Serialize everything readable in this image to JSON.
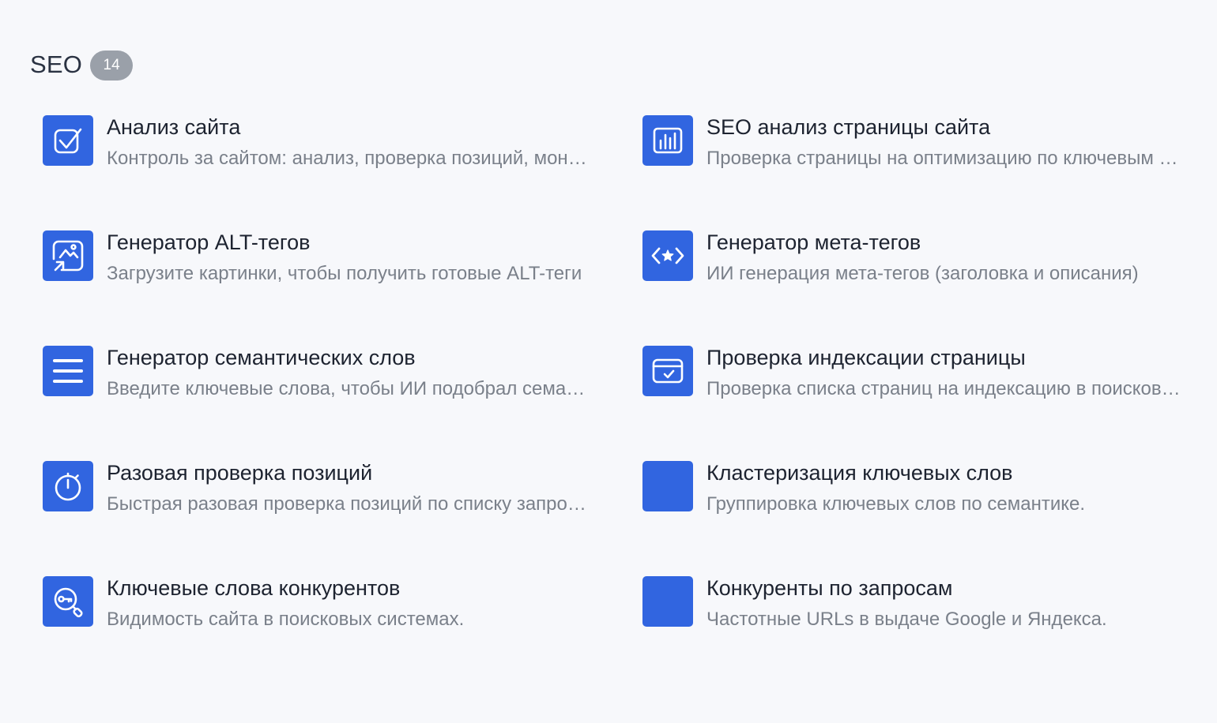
{
  "section": {
    "title": "SEO",
    "count": "14"
  },
  "tools": [
    {
      "title": "Анализ сайта",
      "desc": "Контроль за сайтом: анализ, проверка позиций, мониторинг",
      "icon": "check-icon"
    },
    {
      "title": "SEO анализ страницы сайта",
      "desc": "Проверка страницы на оптимизацию по ключевым словам",
      "icon": "bar-chart-icon"
    },
    {
      "title": "Генератор ALT-тегов",
      "desc": "Загрузите картинки, чтобы получить готовые ALT-теги",
      "icon": "image-upload-icon"
    },
    {
      "title": "Генератор мета-тегов",
      "desc": "ИИ генерация мета-тегов (заголовка и описания)",
      "icon": "code-star-icon"
    },
    {
      "title": "Генератор семантических слов",
      "desc": "Введите ключевые слова, чтобы ИИ подобрал семантику",
      "icon": "menu-lines-icon"
    },
    {
      "title": "Проверка индексации страницы",
      "desc": "Проверка списка страниц на индексацию в поисковиках",
      "icon": "browser-check-icon"
    },
    {
      "title": "Разовая проверка позиций",
      "desc": "Быстрая разовая проверка позиций по списку запросов",
      "icon": "stopwatch-icon"
    },
    {
      "title": "Кластеризация ключевых слов",
      "desc": "Группировка ключевых слов по семантике.",
      "icon": "blank-icon"
    },
    {
      "title": "Ключевые слова конкурентов",
      "desc": "Видимость сайта в поисковых системах.",
      "icon": "key-search-icon"
    },
    {
      "title": "Конкуренты по запросам",
      "desc": "Частотные URLs в выдаче Google и Яндекса.",
      "icon": "blank-icon"
    }
  ]
}
